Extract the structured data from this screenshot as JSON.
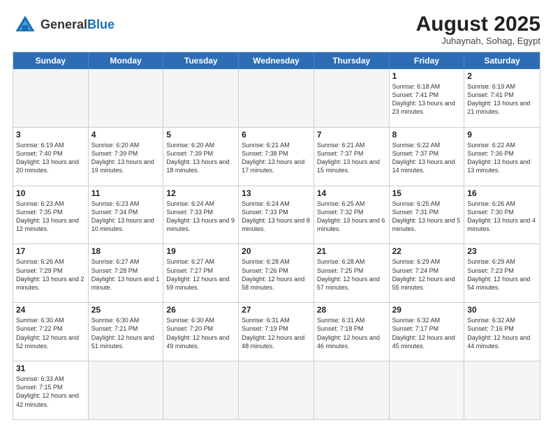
{
  "logo": {
    "text_general": "General",
    "text_blue": "Blue"
  },
  "title": "August 2025",
  "subtitle": "Juhaynah, Sohag, Egypt",
  "header_days": [
    "Sunday",
    "Monday",
    "Tuesday",
    "Wednesday",
    "Thursday",
    "Friday",
    "Saturday"
  ],
  "weeks": [
    [
      {
        "day": "",
        "info": "",
        "empty": true
      },
      {
        "day": "",
        "info": "",
        "empty": true
      },
      {
        "day": "",
        "info": "",
        "empty": true
      },
      {
        "day": "",
        "info": "",
        "empty": true
      },
      {
        "day": "",
        "info": "",
        "empty": true
      },
      {
        "day": "1",
        "info": "Sunrise: 6:18 AM\nSunset: 7:41 PM\nDaylight: 13 hours\nand 23 minutes."
      },
      {
        "day": "2",
        "info": "Sunrise: 6:19 AM\nSunset: 7:41 PM\nDaylight: 13 hours\nand 21 minutes."
      }
    ],
    [
      {
        "day": "3",
        "info": "Sunrise: 6:19 AM\nSunset: 7:40 PM\nDaylight: 13 hours\nand 20 minutes."
      },
      {
        "day": "4",
        "info": "Sunrise: 6:20 AM\nSunset: 7:39 PM\nDaylight: 13 hours\nand 19 minutes."
      },
      {
        "day": "5",
        "info": "Sunrise: 6:20 AM\nSunset: 7:39 PM\nDaylight: 13 hours\nand 18 minutes."
      },
      {
        "day": "6",
        "info": "Sunrise: 6:21 AM\nSunset: 7:38 PM\nDaylight: 13 hours\nand 17 minutes."
      },
      {
        "day": "7",
        "info": "Sunrise: 6:21 AM\nSunset: 7:37 PM\nDaylight: 13 hours\nand 15 minutes."
      },
      {
        "day": "8",
        "info": "Sunrise: 6:22 AM\nSunset: 7:37 PM\nDaylight: 13 hours\nand 14 minutes."
      },
      {
        "day": "9",
        "info": "Sunrise: 6:22 AM\nSunset: 7:36 PM\nDaylight: 13 hours\nand 13 minutes."
      }
    ],
    [
      {
        "day": "10",
        "info": "Sunrise: 6:23 AM\nSunset: 7:35 PM\nDaylight: 13 hours\nand 12 minutes."
      },
      {
        "day": "11",
        "info": "Sunrise: 6:23 AM\nSunset: 7:34 PM\nDaylight: 13 hours\nand 10 minutes."
      },
      {
        "day": "12",
        "info": "Sunrise: 6:24 AM\nSunset: 7:33 PM\nDaylight: 13 hours\nand 9 minutes."
      },
      {
        "day": "13",
        "info": "Sunrise: 6:24 AM\nSunset: 7:33 PM\nDaylight: 13 hours\nand 8 minutes."
      },
      {
        "day": "14",
        "info": "Sunrise: 6:25 AM\nSunset: 7:32 PM\nDaylight: 13 hours\nand 6 minutes."
      },
      {
        "day": "15",
        "info": "Sunrise: 6:25 AM\nSunset: 7:31 PM\nDaylight: 13 hours\nand 5 minutes."
      },
      {
        "day": "16",
        "info": "Sunrise: 6:26 AM\nSunset: 7:30 PM\nDaylight: 13 hours\nand 4 minutes."
      }
    ],
    [
      {
        "day": "17",
        "info": "Sunrise: 6:26 AM\nSunset: 7:29 PM\nDaylight: 13 hours\nand 2 minutes."
      },
      {
        "day": "18",
        "info": "Sunrise: 6:27 AM\nSunset: 7:28 PM\nDaylight: 13 hours\nand 1 minute."
      },
      {
        "day": "19",
        "info": "Sunrise: 6:27 AM\nSunset: 7:27 PM\nDaylight: 12 hours\nand 59 minutes."
      },
      {
        "day": "20",
        "info": "Sunrise: 6:28 AM\nSunset: 7:26 PM\nDaylight: 12 hours\nand 58 minutes."
      },
      {
        "day": "21",
        "info": "Sunrise: 6:28 AM\nSunset: 7:25 PM\nDaylight: 12 hours\nand 57 minutes."
      },
      {
        "day": "22",
        "info": "Sunrise: 6:29 AM\nSunset: 7:24 PM\nDaylight: 12 hours\nand 55 minutes."
      },
      {
        "day": "23",
        "info": "Sunrise: 6:29 AM\nSunset: 7:23 PM\nDaylight: 12 hours\nand 54 minutes."
      }
    ],
    [
      {
        "day": "24",
        "info": "Sunrise: 6:30 AM\nSunset: 7:22 PM\nDaylight: 12 hours\nand 52 minutes."
      },
      {
        "day": "25",
        "info": "Sunrise: 6:30 AM\nSunset: 7:21 PM\nDaylight: 12 hours\nand 51 minutes."
      },
      {
        "day": "26",
        "info": "Sunrise: 6:30 AM\nSunset: 7:20 PM\nDaylight: 12 hours\nand 49 minutes."
      },
      {
        "day": "27",
        "info": "Sunrise: 6:31 AM\nSunset: 7:19 PM\nDaylight: 12 hours\nand 48 minutes."
      },
      {
        "day": "28",
        "info": "Sunrise: 6:31 AM\nSunset: 7:18 PM\nDaylight: 12 hours\nand 46 minutes."
      },
      {
        "day": "29",
        "info": "Sunrise: 6:32 AM\nSunset: 7:17 PM\nDaylight: 12 hours\nand 45 minutes."
      },
      {
        "day": "30",
        "info": "Sunrise: 6:32 AM\nSunset: 7:16 PM\nDaylight: 12 hours\nand 44 minutes."
      }
    ],
    [
      {
        "day": "31",
        "info": "Sunrise: 6:33 AM\nSunset: 7:15 PM\nDaylight: 12 hours\nand 42 minutes."
      },
      {
        "day": "",
        "info": "",
        "empty": true
      },
      {
        "day": "",
        "info": "",
        "empty": true
      },
      {
        "day": "",
        "info": "",
        "empty": true
      },
      {
        "day": "",
        "info": "",
        "empty": true
      },
      {
        "day": "",
        "info": "",
        "empty": true
      },
      {
        "day": "",
        "info": "",
        "empty": true
      }
    ]
  ]
}
